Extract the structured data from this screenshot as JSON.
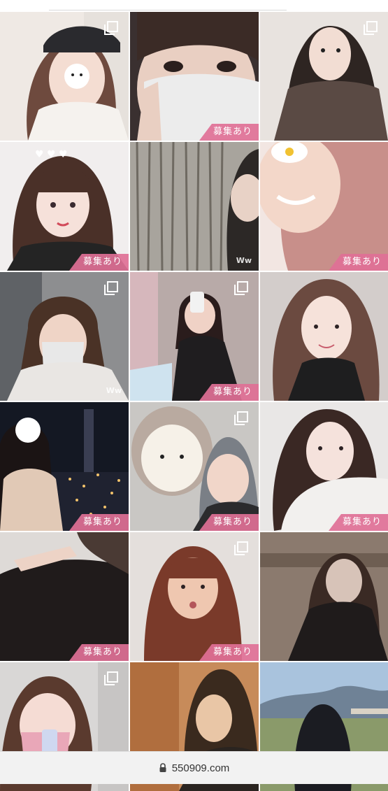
{
  "footer": {
    "domain": "550909.com"
  },
  "colors": {
    "badge": "#e07096",
    "bar": "#f2f2f2"
  },
  "tiles": [
    {
      "badge": "",
      "multi": true,
      "ww": "",
      "scene": "girl-white-cap-sticker"
    },
    {
      "badge": "募集あり",
      "multi": false,
      "ww": "",
      "scene": "girl-white-mask"
    },
    {
      "badge": "",
      "multi": true,
      "ww": "",
      "scene": "girl-brown-dress"
    },
    {
      "badge": "募集あり",
      "multi": false,
      "ww": "",
      "scene": "girl-hearts-filter"
    },
    {
      "badge": "",
      "multi": false,
      "ww": "Ww",
      "scene": "bamboo-forest"
    },
    {
      "badge": "募集あり",
      "multi": false,
      "ww": "",
      "scene": "girl-pink-hair-closeup"
    },
    {
      "badge": "",
      "multi": true,
      "ww": "Ww",
      "scene": "girl-mask-station"
    },
    {
      "badge": "募集あり",
      "multi": true,
      "ww": "",
      "scene": "girl-mirror-selfie"
    },
    {
      "badge": "",
      "multi": false,
      "ww": "",
      "scene": "girl-long-hair-smile"
    },
    {
      "badge": "募集あり",
      "multi": false,
      "ww": "",
      "scene": "girl-night-city"
    },
    {
      "badge": "募集あり",
      "multi": true,
      "ww": "",
      "scene": "girl-with-illustration"
    },
    {
      "badge": "募集あり",
      "multi": false,
      "ww": "",
      "scene": "girl-white-scarf"
    },
    {
      "badge": "募集あり",
      "multi": false,
      "ww": "",
      "scene": "hand-black-blouse"
    },
    {
      "badge": "募集あり",
      "multi": true,
      "ww": "",
      "scene": "girl-red-hair-kiss"
    },
    {
      "badge": "",
      "multi": false,
      "ww": "",
      "scene": "girl-cafe-black-dress"
    },
    {
      "badge": "",
      "multi": true,
      "ww": "",
      "scene": "girl-pink-mask-phone"
    },
    {
      "badge": "",
      "multi": false,
      "ww": "",
      "scene": "girl-kitchen-sideview"
    },
    {
      "badge": "",
      "multi": false,
      "ww": "",
      "scene": "girl-back-landscape"
    }
  ]
}
